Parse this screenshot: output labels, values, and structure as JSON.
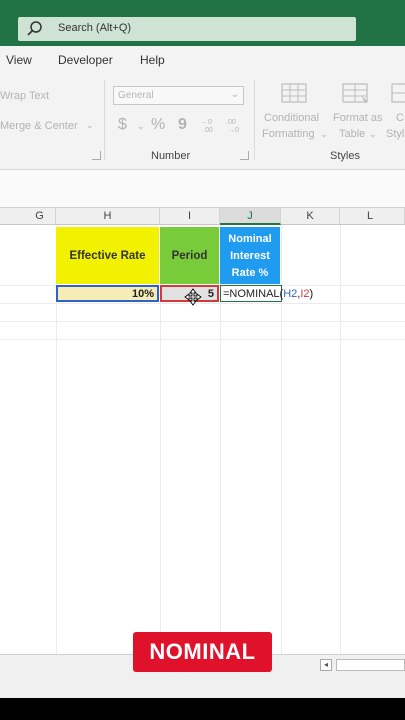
{
  "search": {
    "placeholder": "Search (Alt+Q)"
  },
  "menu": {
    "items": [
      "View",
      "Developer",
      "Help"
    ]
  },
  "ribbon": {
    "wrap_text": "Wrap Text",
    "merge_center": "Merge & Center",
    "number_format": "General",
    "number_symbols": {
      "currency": "$",
      "percent": "%",
      "comma": "9"
    },
    "conditional_formatting": [
      "Conditional",
      "Formatting"
    ],
    "format_as_table": [
      "Format as",
      "Table"
    ],
    "cell_styles": [
      "C",
      "Styl"
    ],
    "groups": {
      "number": "Number",
      "styles": "Styles"
    }
  },
  "columns": [
    "G",
    "H",
    "I",
    "J",
    "K",
    "L"
  ],
  "sheet": {
    "headers": {
      "h": "Effective Rate",
      "i": "Period",
      "j": [
        "Nominal",
        "Interest",
        "Rate %"
      ]
    },
    "row2": {
      "h": "10%",
      "i": "5",
      "formula_prefix": "=NOMINAL(",
      "ref_h": "H2",
      "sep": ",",
      "ref_i": "I2",
      "formula_suffix": ")"
    }
  },
  "badge": "NOMINAL",
  "colors": {
    "excel_green": "#217346",
    "yellow": "#f2f200",
    "green": "#78cc3a",
    "blue": "#1f9bf0",
    "badge_red": "#e0112b"
  }
}
